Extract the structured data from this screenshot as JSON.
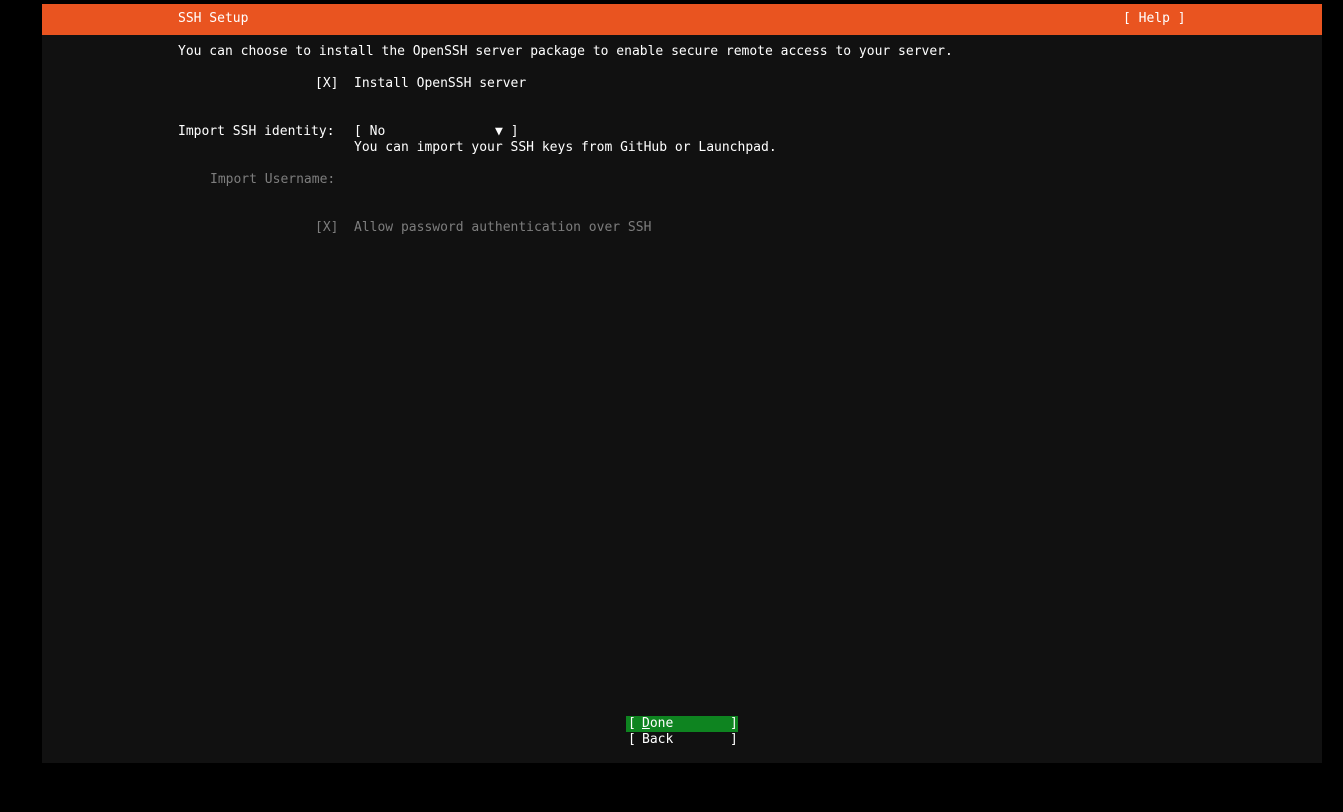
{
  "header": {
    "title": "SSH Setup",
    "help_label": "[ Help ]"
  },
  "description": "You can choose to install the OpenSSH server package to enable secure remote access to your server.",
  "install_openssh": {
    "checkbox": "[X]",
    "label": "Install OpenSSH server"
  },
  "import_identity": {
    "label": "Import SSH identity:",
    "open_bracket": "[ ",
    "value": "No",
    "arrow": "▼",
    "close_bracket": "]",
    "help": "You can import your SSH keys from GitHub or Launchpad."
  },
  "import_username": {
    "label": "Import Username:"
  },
  "allow_password": {
    "checkbox": "[X]",
    "label": "Allow password authentication over SSH"
  },
  "buttons": {
    "open": "[",
    "close": "]",
    "done_first": "D",
    "done_rest": "one",
    "back": "Back"
  },
  "colors": {
    "accent": "#e95420",
    "focus": "#0e8420",
    "background": "#111111",
    "disabled_text": "#7d7d7d"
  }
}
